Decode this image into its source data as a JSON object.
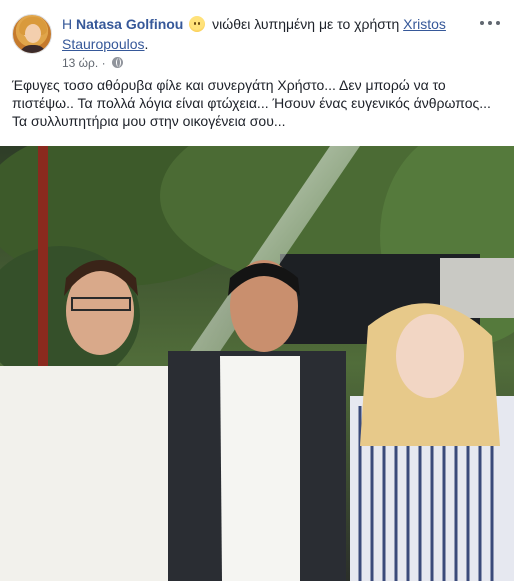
{
  "post": {
    "author_prefix": "Η",
    "author_name": "Natasa Golfinou",
    "feeling_text": "νιώθει λυπημένη με το χρήστη",
    "tagged_user": "Xristos Stauropoulos",
    "tagged_suffix": ".",
    "timestamp": "13 ώρ.",
    "timestamp_separator": "·",
    "message_lines": [
      "Έφυγες τοσο αθόρυβα φίλε και συνεργάτη Χρήστο... Δεν μπορώ να το",
      "πιστέψω.. Τα πολλά λόγια είναι φτώχεια... Ήσουν ένας ευγενικός άνθρωπος...",
      "Τα συλλυπητήρια μου στην οικογένεια σου..."
    ]
  },
  "icons": {
    "feeling": "sad-face-emoji-icon",
    "audience": "globe-icon",
    "more": "more-options-icon"
  },
  "colors": {
    "link": "#365899",
    "text": "#1d2129",
    "meta": "#616770"
  }
}
